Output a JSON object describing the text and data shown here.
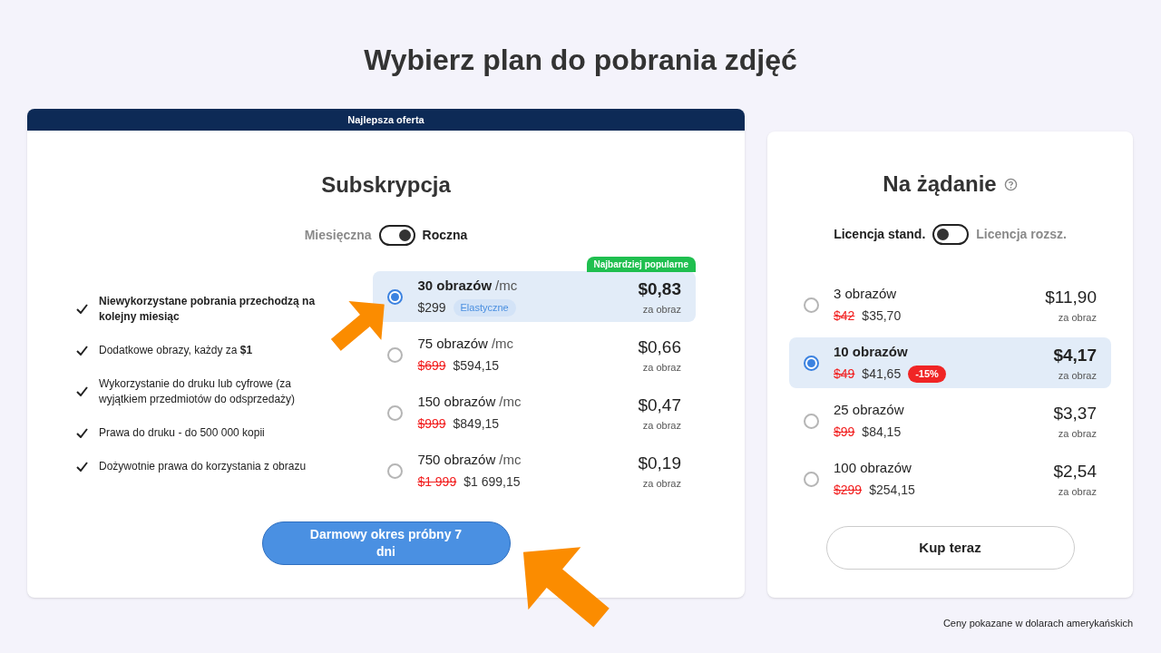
{
  "page_title": "Wybierz plan do pobrania zdjęć",
  "subscription": {
    "banner": "Najlepsza oferta",
    "title": "Subskrypcja",
    "toggle": {
      "left_label": "Miesięczna",
      "right_label": "Roczna",
      "on": true
    },
    "features": [
      {
        "text": "Niewykorzystane pobrania przechodzą na kolejny miesiąc",
        "bold": true
      },
      {
        "text": "Dodatkowe obrazy, każdy za **$1**",
        "bold": false
      },
      {
        "text": "Wykorzystanie do druku lub cyfrowe (za wyjątkiem przedmiotów do odsprzedaży)",
        "bold": false
      },
      {
        "text": "Prawa do druku - do 500 000 kopii",
        "bold": false
      },
      {
        "text": "Dożywotnie prawa do korzystania z obrazu",
        "bold": false
      }
    ],
    "plans": [
      {
        "name": "30 obrazów",
        "unit": "/mc",
        "price": "$299",
        "tag": "Elastyczne",
        "ribbon": "Najbardziej popularne",
        "per_image": "$0,83",
        "per_label": "za obraz",
        "selected": true
      },
      {
        "name": "75 obrazów",
        "unit": "/mc",
        "old_price": "$699",
        "price": "$594,15",
        "per_image": "$0,66",
        "per_label": "za obraz",
        "selected": false
      },
      {
        "name": "150 obrazów",
        "unit": "/mc",
        "old_price": "$999",
        "price": "$849,15",
        "per_image": "$0,47",
        "per_label": "za obraz",
        "selected": false
      },
      {
        "name": "750 obrazów",
        "unit": "/mc",
        "old_price": "$1 999",
        "price": "$1 699,15",
        "per_image": "$0,19",
        "per_label": "za obraz",
        "selected": false
      }
    ],
    "button": "Darmowy okres próbny 7 dni"
  },
  "on_demand": {
    "title": "Na żądanie",
    "toggle": {
      "left_label": "Licencja stand.",
      "right_label": "Licencja rozsz.",
      "on": false
    },
    "plans": [
      {
        "name": "3 obrazów",
        "old_price": "$42",
        "price": "$35,70",
        "per_image": "$11,90",
        "per_label": "za obraz",
        "selected": false
      },
      {
        "name": "10 obrazów",
        "old_price": "$49",
        "price": "$41,65",
        "discount": "-15%",
        "per_image": "$4,17",
        "per_label": "za obraz",
        "selected": true
      },
      {
        "name": "25 obrazów",
        "old_price": "$99",
        "price": "$84,15",
        "per_image": "$3,37",
        "per_label": "za obraz",
        "selected": false
      },
      {
        "name": "100 obrazów",
        "old_price": "$299",
        "price": "$254,15",
        "per_image": "$2,54",
        "per_label": "za obraz",
        "selected": false
      }
    ],
    "button": "Kup teraz"
  },
  "footnote": "Ceny pokazane w dolarach amerykańskich"
}
